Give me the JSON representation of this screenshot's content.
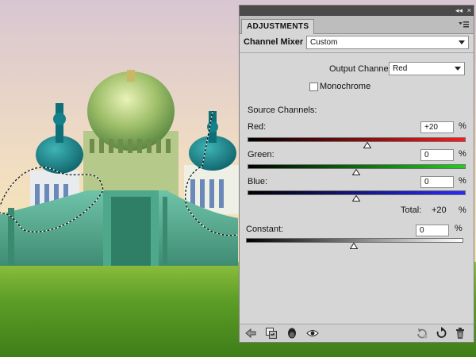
{
  "panel": {
    "title": "ADJUSTMENTS",
    "collapse_glyph": "◂◂",
    "close_glyph": "×",
    "preset_label": "Channel Mixer",
    "preset_value": "Custom",
    "output_channel_label": "Output Channel:",
    "output_channel_value": "Red",
    "monochrome_label": "Monochrome",
    "monochrome_checked": false,
    "source_channels_label": "Source Channels:",
    "channels": [
      {
        "label": "Red:",
        "value": "+20",
        "unit": "%",
        "slider_percent": 20,
        "color": "#d00000"
      },
      {
        "label": "Green:",
        "value": "0",
        "unit": "%",
        "slider_percent": 0,
        "color": "#00b000"
      },
      {
        "label": "Blue:",
        "value": "0",
        "unit": "%",
        "slider_percent": 0,
        "color": "#0000d0"
      }
    ],
    "total_label": "Total:",
    "total_value": "+20",
    "total_unit": "%",
    "constant_label": "Constant:",
    "constant_value": "0",
    "constant_unit": "%",
    "constant_slider_percent": 0,
    "bottom_icons_left": [
      "back-arrow-icon",
      "clip-to-layer-icon",
      "layer-visibility-state-icon",
      "eye-icon"
    ],
    "bottom_icons_right": [
      "reset-to-previous-icon",
      "reset-to-default-icon",
      "trash-icon"
    ]
  },
  "colors": {
    "panel_bg": "#d6d6d6",
    "sky_top": "#d9c9cf",
    "grass": "#5fa12a",
    "teal_dome": "#127d86",
    "wall": "#5fb89d"
  }
}
